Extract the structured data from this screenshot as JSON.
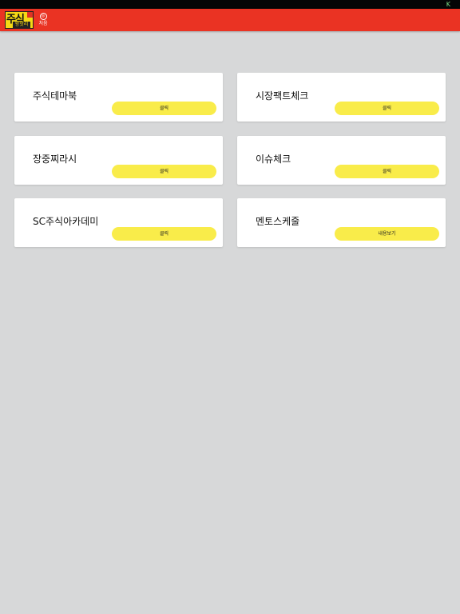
{
  "status_bar": {
    "icon_name": "notification-icon",
    "icon_glyph": "K"
  },
  "header": {
    "logo_main": "주식",
    "logo_sub": "왕핫리",
    "home_label": "처음",
    "home_icon_glyph": "◎"
  },
  "cards": [
    {
      "title": "주식테마북",
      "button_label": "클릭"
    },
    {
      "title": "시장팩트체크",
      "button_label": "클릭"
    },
    {
      "title": "장중찌라시",
      "button_label": "클릭"
    },
    {
      "title": "이슈체크",
      "button_label": "클릭"
    },
    {
      "title": "SC주식아카데미",
      "button_label": "클릭"
    },
    {
      "title": "멘토스케줄",
      "button_label": "내용보기"
    }
  ],
  "colors": {
    "header": "#ea3323",
    "accent_button": "#f9ec4a",
    "background": "#d7d8d9",
    "status_bar": "#050505"
  }
}
